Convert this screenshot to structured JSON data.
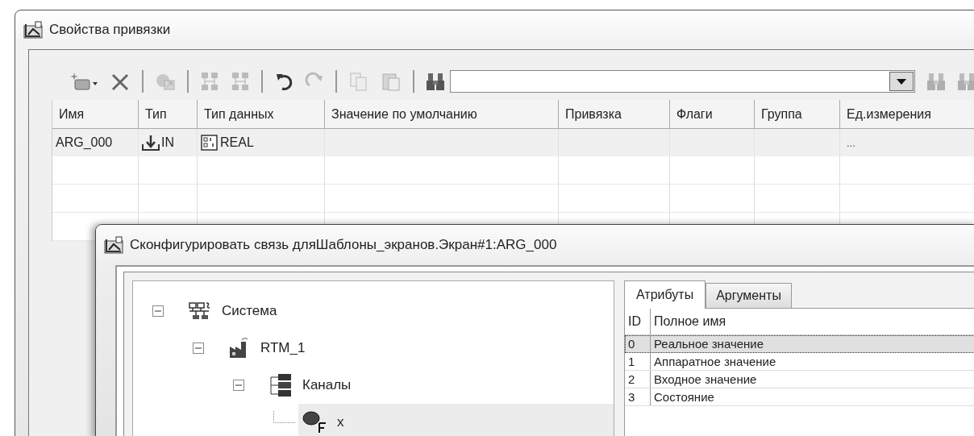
{
  "window": {
    "title": "Свойства привязки"
  },
  "toolbar": [
    {
      "kind": "new",
      "disabled": false
    },
    {
      "kind": "delete",
      "disabled": false
    },
    {
      "kind": "sep"
    },
    {
      "kind": "link",
      "disabled": true
    },
    {
      "kind": "sep"
    },
    {
      "kind": "tree-down",
      "disabled": true
    },
    {
      "kind": "tree-up",
      "disabled": true
    },
    {
      "kind": "sep"
    },
    {
      "kind": "undo",
      "disabled": false
    },
    {
      "kind": "redo",
      "disabled": true
    },
    {
      "kind": "sep"
    },
    {
      "kind": "copy",
      "disabled": true
    },
    {
      "kind": "paste",
      "disabled": true
    },
    {
      "kind": "sep"
    },
    {
      "kind": "find",
      "disabled": false
    },
    {
      "kind": "search"
    },
    {
      "kind": "find-next",
      "disabled": true
    },
    {
      "kind": "find-prev",
      "disabled": true
    }
  ],
  "table": {
    "columns": [
      "Имя",
      "Тип",
      "Тип данных",
      "Значение по умолчанию",
      "Привязка",
      "Флаги",
      "Группа",
      "Ед.измерения"
    ],
    "rows": [
      {
        "name": "ARG_000",
        "type": "IN",
        "data_type": "REAL",
        "units": "..."
      }
    ]
  },
  "dialog": {
    "title": "Сконфигурировать связь дляШаблоны_экранов.Экран#1:ARG_000",
    "tree": [
      {
        "label": "Система",
        "kind": "system",
        "expanded": true,
        "selected": false,
        "children": [
          {
            "label": "RTM_1",
            "kind": "rtm",
            "expanded": true,
            "selected": false,
            "children": [
              {
                "label": "Каналы",
                "kind": "channels",
                "expanded": true,
                "selected": false,
                "children": [
                  {
                    "label": "x",
                    "kind": "channel",
                    "selected": true
                  }
                ]
              }
            ]
          }
        ]
      }
    ],
    "tabs": [
      {
        "label": "Атрибуты",
        "selected": true
      },
      {
        "label": "Аргументы",
        "selected": false
      }
    ],
    "attributes": {
      "columns": [
        "ID",
        "Полное имя"
      ],
      "rows": [
        {
          "id": "0",
          "name": "Реальное значение",
          "selected": true
        },
        {
          "id": "1",
          "name": "Аппаратное значение",
          "selected": false
        },
        {
          "id": "2",
          "name": "Входное значение",
          "selected": false
        },
        {
          "id": "3",
          "name": "Состояние",
          "selected": false
        }
      ]
    }
  }
}
